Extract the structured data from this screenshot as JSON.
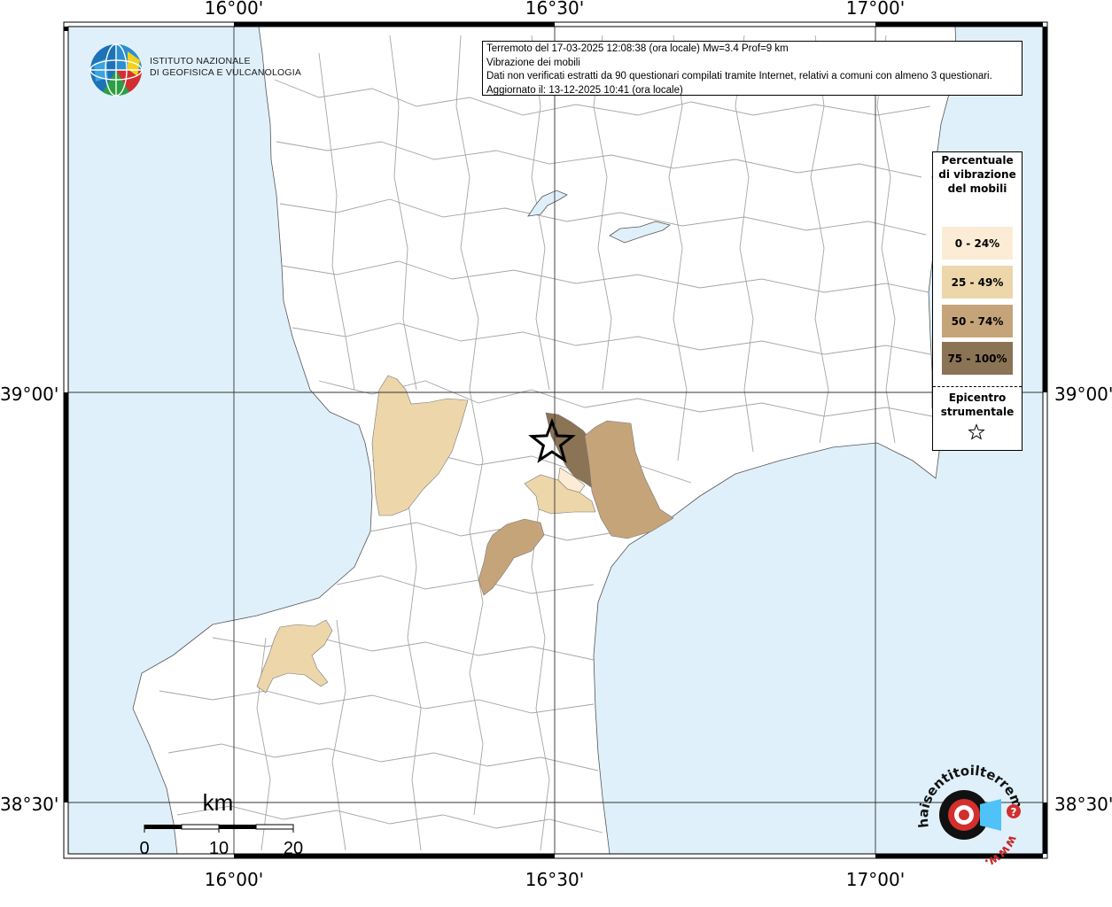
{
  "info_box": {
    "line1": "Terremoto del 17-03-2025 12:08:38 (ora locale) Mw=3.4 Prof=9 km",
    "line2": "Vibrazione dei mobili",
    "line3": "Dati non verificati estratti da 90 questionari compilati tramite Internet, relativi a comuni con almeno 3 questionari.",
    "line4": "Aggiornato il: 13-12-2025 10:41 (ora locale)"
  },
  "axes": {
    "top_labels": [
      "16°00'",
      "16°30'",
      "17°00'"
    ],
    "bottom_labels": [
      "16°00'",
      "16°30'",
      "17°00'"
    ],
    "left_labels": [
      "39°00'",
      "38°30'"
    ],
    "right_labels": [
      "39°00'",
      "38°30'"
    ]
  },
  "legend": {
    "title": "Percentuale di vibrazione del mobili",
    "items": [
      {
        "label": "0 - 24%",
        "color": "#fcecd6"
      },
      {
        "label": "25 - 49%",
        "color": "#ecd6aa"
      },
      {
        "label": "50 - 74%",
        "color": "#c6a47a"
      },
      {
        "label": "75 - 100%",
        "color": "#8b7355"
      }
    ],
    "epicenter_label": "Epicentro strumentale",
    "epicenter_icon": "star-icon"
  },
  "logo": {
    "line1": "ISTITUTO NAZIONALE",
    "line2": "DI GEOFISICA E VULCANOLOGIA",
    "hst_text": "haisentitoilterremoto.it",
    "hst_www": "www."
  },
  "scale": {
    "unit": "km",
    "ticks": [
      "0",
      "10",
      "20"
    ]
  },
  "colors": {
    "sea": "#dff0fb",
    "land": "#ffffff",
    "boundary": "#a0a0a0",
    "c0": "#fcecd6",
    "c1": "#ecd6aa",
    "c2": "#c6a47a",
    "c3": "#8b7355"
  }
}
